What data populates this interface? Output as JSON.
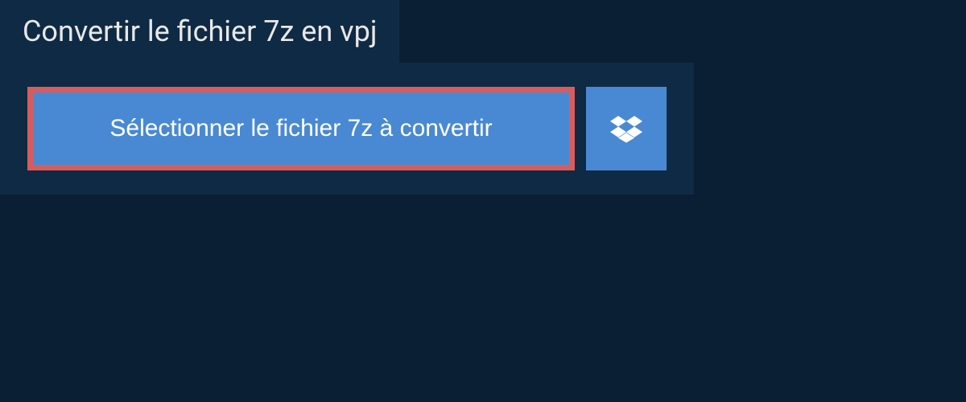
{
  "header": {
    "title": "Convertir le fichier 7z en vpj"
  },
  "upload": {
    "select_button_label": "Sélectionner le fichier 7z à convertir"
  }
}
